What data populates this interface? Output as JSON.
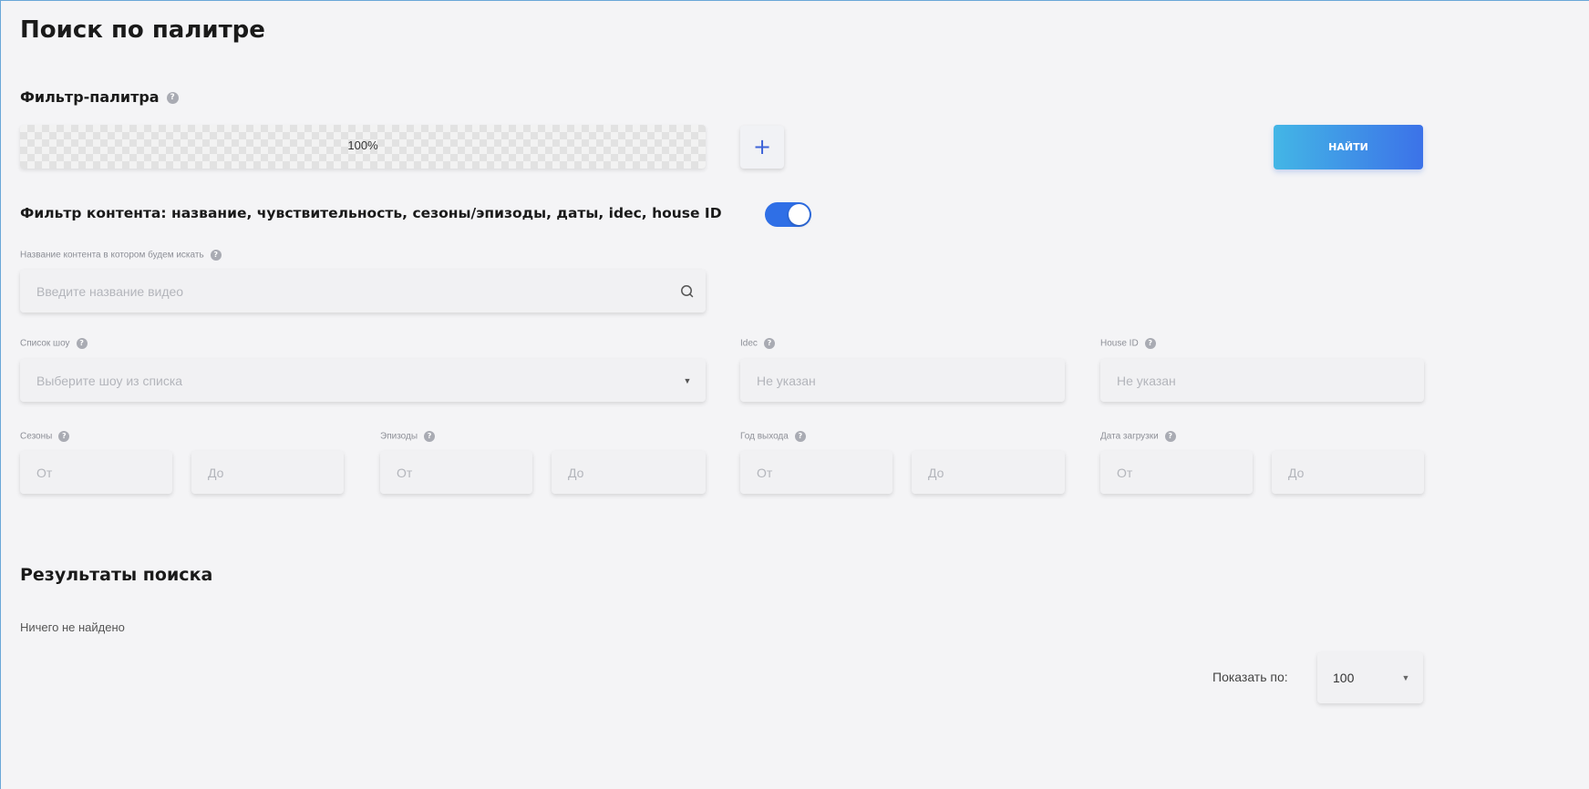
{
  "page": {
    "title": "Поиск по палитре"
  },
  "palette_filter": {
    "label": "Фильтр-палитра",
    "help_icon": "help-icon",
    "percent": "100%",
    "add_label": "+",
    "find_label": "НАЙТИ"
  },
  "content_filter": {
    "label": "Фильтр контента: название, чувствительность, сезоны/эпизоды, даты, idec, house ID",
    "toggle_on": true,
    "accent_color": "#2f6fe6"
  },
  "content_name": {
    "label": "Название контента в котором будем искать",
    "placeholder": "Введите название видео",
    "icon": "search-icon"
  },
  "show_list": {
    "label": "Список шоу",
    "placeholder": "Выберите шоу из списка"
  },
  "idec": {
    "label": "Idec",
    "placeholder": "Не указан"
  },
  "house_id": {
    "label": "House ID",
    "placeholder": "Не указан"
  },
  "ranges": {
    "seasons": {
      "label": "Сезоны",
      "from": "От",
      "to": "До"
    },
    "episodes": {
      "label": "Эпизоды",
      "from": "От",
      "to": "До"
    },
    "year": {
      "label": "Год выхода",
      "from": "От",
      "to": "До"
    },
    "upload_date": {
      "label": "Дата загрузки",
      "from": "От",
      "to": "До"
    }
  },
  "results": {
    "title": "Результаты поиска",
    "empty_text": "Ничего не найдено",
    "page_size_label": "Показать по:",
    "page_size_value": "100"
  },
  "colors": {
    "button_gradient_start": "#43b6e6",
    "button_gradient_end": "#3c72e8",
    "background": "#f4f4f6"
  }
}
